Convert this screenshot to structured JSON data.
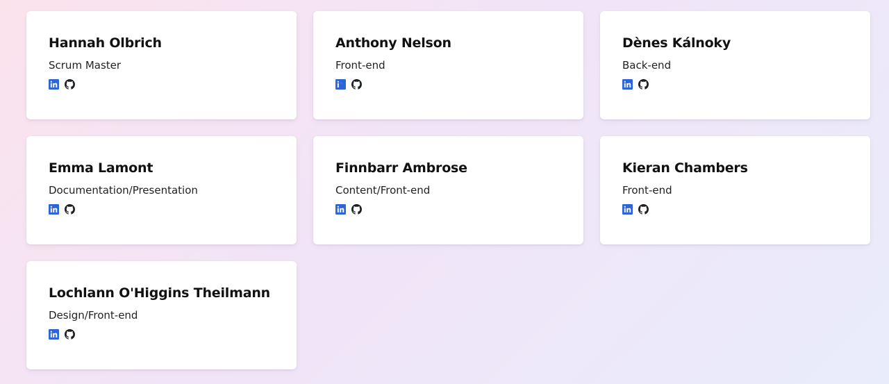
{
  "colors": {
    "linkedin": "#2d64d6",
    "github": "#1b1f23"
  },
  "icons": {
    "linkedin": "linkedin-icon",
    "github": "github-icon"
  },
  "members": [
    {
      "name": "Hannah Olbrich",
      "role": "Scrum Master"
    },
    {
      "name": "Anthony Nelson",
      "role": "Front-end"
    },
    {
      "name": "Dènes Kálnoky",
      "role": "Back-end"
    },
    {
      "name": "Emma Lamont",
      "role": "Documentation/Presentation"
    },
    {
      "name": "Finnbarr Ambrose",
      "role": "Content/Front-end"
    },
    {
      "name": "Kieran Chambers",
      "role": "Front-end"
    },
    {
      "name": "Lochlann O'Higgins Theilmann",
      "role": "Design/Front-end"
    }
  ]
}
